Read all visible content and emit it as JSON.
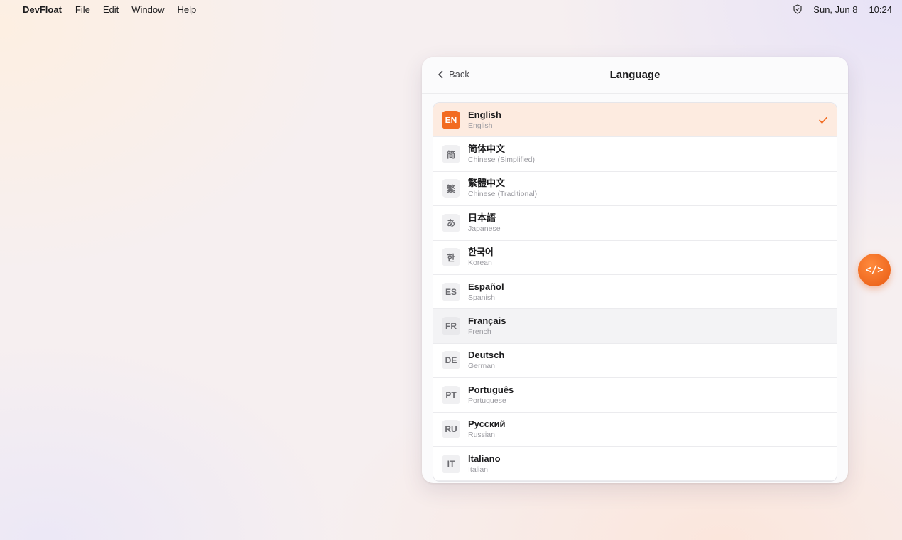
{
  "menubar": {
    "app_name": "DevFloat",
    "items": [
      "File",
      "Edit",
      "Window",
      "Help"
    ],
    "date": "Sun, Jun 8",
    "time": "10:24",
    "status_icon": "shield-icon"
  },
  "panel": {
    "back_label": "Back",
    "title": "Language",
    "languages": [
      {
        "code": "EN",
        "native": "English",
        "english": "English",
        "selected": true
      },
      {
        "code": "简",
        "native": "简体中文",
        "english": "Chinese (Simplified)"
      },
      {
        "code": "繁",
        "native": "繁體中文",
        "english": "Chinese (Traditional)"
      },
      {
        "code": "あ",
        "native": "日本語",
        "english": "Japanese"
      },
      {
        "code": "한",
        "native": "한국어",
        "english": "Korean"
      },
      {
        "code": "ES",
        "native": "Español",
        "english": "Spanish"
      },
      {
        "code": "FR",
        "native": "Français",
        "english": "French",
        "hovered": true
      },
      {
        "code": "DE",
        "native": "Deutsch",
        "english": "German"
      },
      {
        "code": "PT",
        "native": "Português",
        "english": "Portuguese"
      },
      {
        "code": "RU",
        "native": "Русский",
        "english": "Russian"
      },
      {
        "code": "IT",
        "native": "Italiano",
        "english": "Italian"
      }
    ]
  },
  "fab": {
    "label": "</>"
  },
  "colors": {
    "accent": "#f26b21",
    "selected_row": "#fdebe0"
  }
}
